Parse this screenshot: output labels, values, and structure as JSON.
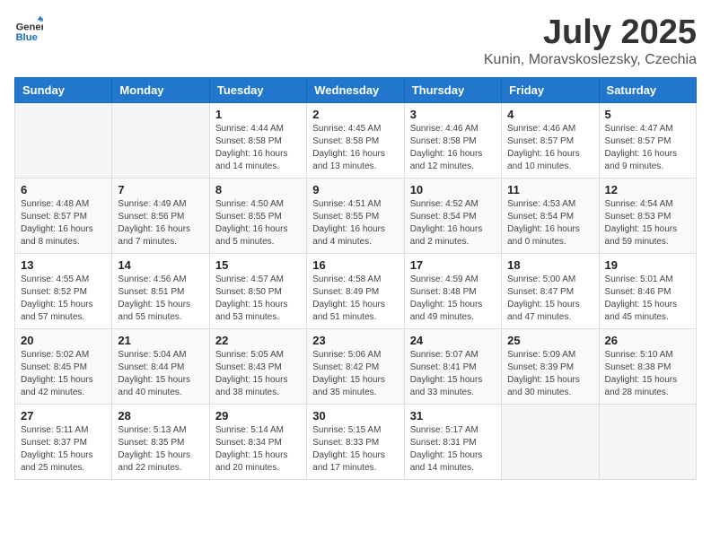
{
  "header": {
    "logo_general": "General",
    "logo_blue": "Blue",
    "month": "July 2025",
    "location": "Kunin, Moravskoslezsky, Czechia"
  },
  "weekdays": [
    "Sunday",
    "Monday",
    "Tuesday",
    "Wednesday",
    "Thursday",
    "Friday",
    "Saturday"
  ],
  "weeks": [
    [
      {
        "day": "",
        "sunrise": "",
        "sunset": "",
        "daylight": ""
      },
      {
        "day": "",
        "sunrise": "",
        "sunset": "",
        "daylight": ""
      },
      {
        "day": "1",
        "sunrise": "Sunrise: 4:44 AM",
        "sunset": "Sunset: 8:58 PM",
        "daylight": "Daylight: 16 hours and 14 minutes."
      },
      {
        "day": "2",
        "sunrise": "Sunrise: 4:45 AM",
        "sunset": "Sunset: 8:58 PM",
        "daylight": "Daylight: 16 hours and 13 minutes."
      },
      {
        "day": "3",
        "sunrise": "Sunrise: 4:46 AM",
        "sunset": "Sunset: 8:58 PM",
        "daylight": "Daylight: 16 hours and 12 minutes."
      },
      {
        "day": "4",
        "sunrise": "Sunrise: 4:46 AM",
        "sunset": "Sunset: 8:57 PM",
        "daylight": "Daylight: 16 hours and 10 minutes."
      },
      {
        "day": "5",
        "sunrise": "Sunrise: 4:47 AM",
        "sunset": "Sunset: 8:57 PM",
        "daylight": "Daylight: 16 hours and 9 minutes."
      }
    ],
    [
      {
        "day": "6",
        "sunrise": "Sunrise: 4:48 AM",
        "sunset": "Sunset: 8:57 PM",
        "daylight": "Daylight: 16 hours and 8 minutes."
      },
      {
        "day": "7",
        "sunrise": "Sunrise: 4:49 AM",
        "sunset": "Sunset: 8:56 PM",
        "daylight": "Daylight: 16 hours and 7 minutes."
      },
      {
        "day": "8",
        "sunrise": "Sunrise: 4:50 AM",
        "sunset": "Sunset: 8:55 PM",
        "daylight": "Daylight: 16 hours and 5 minutes."
      },
      {
        "day": "9",
        "sunrise": "Sunrise: 4:51 AM",
        "sunset": "Sunset: 8:55 PM",
        "daylight": "Daylight: 16 hours and 4 minutes."
      },
      {
        "day": "10",
        "sunrise": "Sunrise: 4:52 AM",
        "sunset": "Sunset: 8:54 PM",
        "daylight": "Daylight: 16 hours and 2 minutes."
      },
      {
        "day": "11",
        "sunrise": "Sunrise: 4:53 AM",
        "sunset": "Sunset: 8:54 PM",
        "daylight": "Daylight: 16 hours and 0 minutes."
      },
      {
        "day": "12",
        "sunrise": "Sunrise: 4:54 AM",
        "sunset": "Sunset: 8:53 PM",
        "daylight": "Daylight: 15 hours and 59 minutes."
      }
    ],
    [
      {
        "day": "13",
        "sunrise": "Sunrise: 4:55 AM",
        "sunset": "Sunset: 8:52 PM",
        "daylight": "Daylight: 15 hours and 57 minutes."
      },
      {
        "day": "14",
        "sunrise": "Sunrise: 4:56 AM",
        "sunset": "Sunset: 8:51 PM",
        "daylight": "Daylight: 15 hours and 55 minutes."
      },
      {
        "day": "15",
        "sunrise": "Sunrise: 4:57 AM",
        "sunset": "Sunset: 8:50 PM",
        "daylight": "Daylight: 15 hours and 53 minutes."
      },
      {
        "day": "16",
        "sunrise": "Sunrise: 4:58 AM",
        "sunset": "Sunset: 8:49 PM",
        "daylight": "Daylight: 15 hours and 51 minutes."
      },
      {
        "day": "17",
        "sunrise": "Sunrise: 4:59 AM",
        "sunset": "Sunset: 8:48 PM",
        "daylight": "Daylight: 15 hours and 49 minutes."
      },
      {
        "day": "18",
        "sunrise": "Sunrise: 5:00 AM",
        "sunset": "Sunset: 8:47 PM",
        "daylight": "Daylight: 15 hours and 47 minutes."
      },
      {
        "day": "19",
        "sunrise": "Sunrise: 5:01 AM",
        "sunset": "Sunset: 8:46 PM",
        "daylight": "Daylight: 15 hours and 45 minutes."
      }
    ],
    [
      {
        "day": "20",
        "sunrise": "Sunrise: 5:02 AM",
        "sunset": "Sunset: 8:45 PM",
        "daylight": "Daylight: 15 hours and 42 minutes."
      },
      {
        "day": "21",
        "sunrise": "Sunrise: 5:04 AM",
        "sunset": "Sunset: 8:44 PM",
        "daylight": "Daylight: 15 hours and 40 minutes."
      },
      {
        "day": "22",
        "sunrise": "Sunrise: 5:05 AM",
        "sunset": "Sunset: 8:43 PM",
        "daylight": "Daylight: 15 hours and 38 minutes."
      },
      {
        "day": "23",
        "sunrise": "Sunrise: 5:06 AM",
        "sunset": "Sunset: 8:42 PM",
        "daylight": "Daylight: 15 hours and 35 minutes."
      },
      {
        "day": "24",
        "sunrise": "Sunrise: 5:07 AM",
        "sunset": "Sunset: 8:41 PM",
        "daylight": "Daylight: 15 hours and 33 minutes."
      },
      {
        "day": "25",
        "sunrise": "Sunrise: 5:09 AM",
        "sunset": "Sunset: 8:39 PM",
        "daylight": "Daylight: 15 hours and 30 minutes."
      },
      {
        "day": "26",
        "sunrise": "Sunrise: 5:10 AM",
        "sunset": "Sunset: 8:38 PM",
        "daylight": "Daylight: 15 hours and 28 minutes."
      }
    ],
    [
      {
        "day": "27",
        "sunrise": "Sunrise: 5:11 AM",
        "sunset": "Sunset: 8:37 PM",
        "daylight": "Daylight: 15 hours and 25 minutes."
      },
      {
        "day": "28",
        "sunrise": "Sunrise: 5:13 AM",
        "sunset": "Sunset: 8:35 PM",
        "daylight": "Daylight: 15 hours and 22 minutes."
      },
      {
        "day": "29",
        "sunrise": "Sunrise: 5:14 AM",
        "sunset": "Sunset: 8:34 PM",
        "daylight": "Daylight: 15 hours and 20 minutes."
      },
      {
        "day": "30",
        "sunrise": "Sunrise: 5:15 AM",
        "sunset": "Sunset: 8:33 PM",
        "daylight": "Daylight: 15 hours and 17 minutes."
      },
      {
        "day": "31",
        "sunrise": "Sunrise: 5:17 AM",
        "sunset": "Sunset: 8:31 PM",
        "daylight": "Daylight: 15 hours and 14 minutes."
      },
      {
        "day": "",
        "sunrise": "",
        "sunset": "",
        "daylight": ""
      },
      {
        "day": "",
        "sunrise": "",
        "sunset": "",
        "daylight": ""
      }
    ]
  ]
}
